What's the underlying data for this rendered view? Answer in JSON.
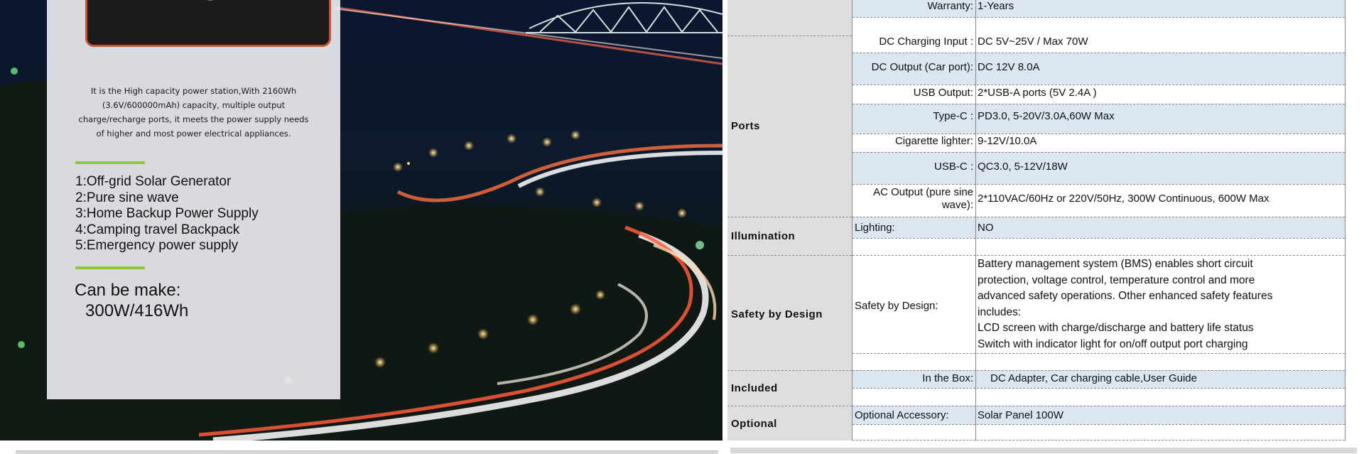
{
  "promo": {
    "intro": "It is the High capacity power station,With 2160Wh (3.6V/600000mAh) capacity, multiple output charge/recharge ports, it meets the power supply needs of higher and most power electrical appliances.",
    "features": [
      "1:Off-grid Solar Generator",
      "2:Pure sine wave",
      "3:Home Backup Power Supply",
      "4:Camping travel Backpack",
      "5:Emergency power supply"
    ],
    "make_label": "Can be make:",
    "make_value": "300W/416Wh",
    "accent_color": "#8dc63f"
  },
  "spec": {
    "warranty": {
      "label": "Warranty:",
      "value": "1-Years"
    },
    "ports": {
      "category": "Ports",
      "rows": [
        {
          "label": "DC Charging Input :",
          "value": "DC 5V~25V / Max 70W"
        },
        {
          "label": "DC Output (Car port):",
          "value": "DC 12V  8.0A"
        },
        {
          "label": "USB Output:",
          "value": "2*USB-A ports (5V 2.4A )"
        },
        {
          "label": "Type-C :",
          "value": "PD3.0, 5-20V/3.0A,60W Max"
        },
        {
          "label": "Cigarette lighter:",
          "value": "9-12V/10.0A"
        },
        {
          "label": "USB-C :",
          "value": "QC3.0, 5-12V/18W"
        },
        {
          "label": "AC Output (pure sine wave):",
          "value": "2*110VAC/60Hz or 220V/50Hz, 300W Continuous, 600W Max"
        }
      ]
    },
    "illumination": {
      "category": "Illumination",
      "label": "Lighting:",
      "value": "NO"
    },
    "safety": {
      "category": "Safety by Design",
      "label": "Safety by Design:",
      "lines": [
        "Battery management system (BMS) enables short circuit",
        "protection, voltage control, temperature control and more",
        "advanced safety operations. Other enhanced safety features",
        "includes:",
        "LCD screen with charge/discharge and battery life status",
        "Switch with indicator light for on/off output port charging"
      ]
    },
    "included": {
      "category": "Included",
      "label": "In the Box:",
      "value": "DC Adapter, Car charging cable,User Guide"
    },
    "optional": {
      "category": "Optional",
      "label": "Optional Accessory:",
      "value": "Solar Panel 100W"
    },
    "band_color": "#dce6f1",
    "category_bg": "#dedede"
  }
}
